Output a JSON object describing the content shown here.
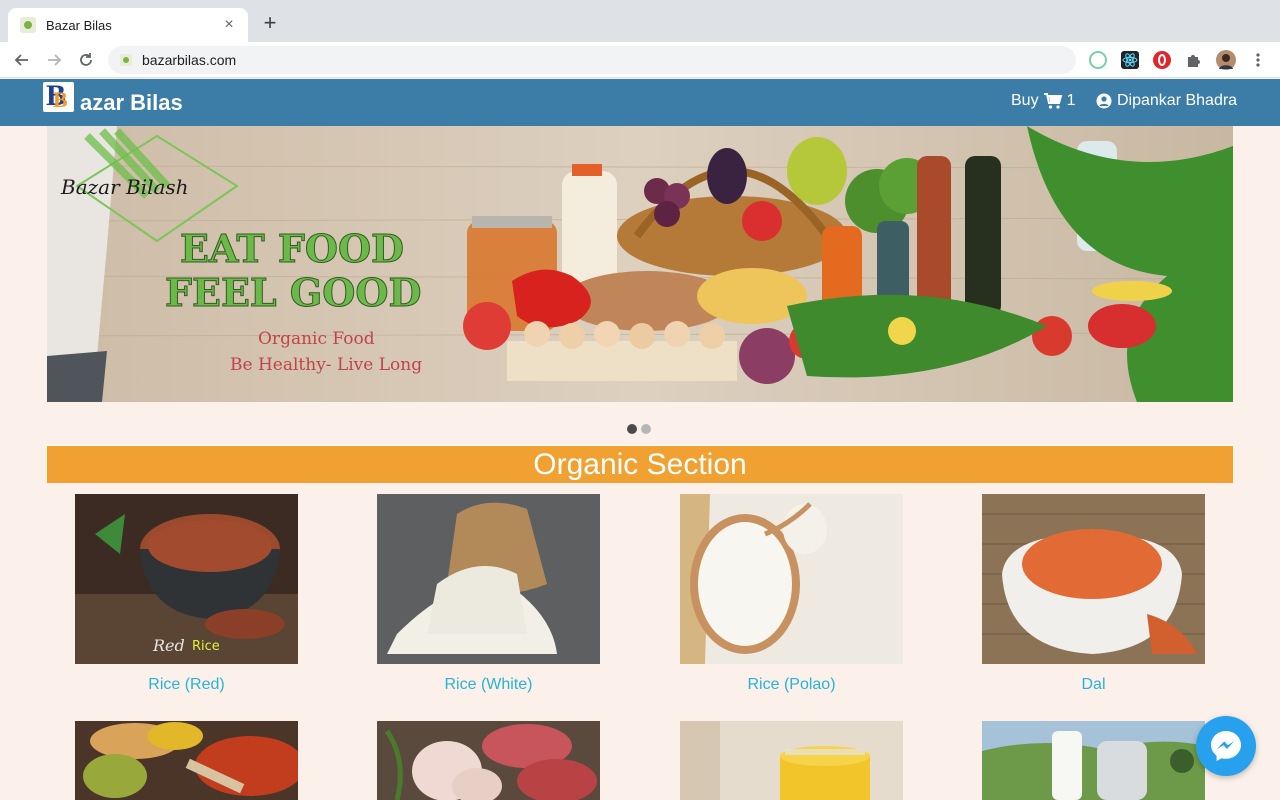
{
  "browser": {
    "tab_title": "Bazar Bilas",
    "close_glyph": "×",
    "new_tab_glyph": "+",
    "url": "bazarbilas.com"
  },
  "header": {
    "brand_name": "azar Bilas",
    "logo_letter": "B",
    "buy_label": "Buy",
    "cart_count": "1",
    "user_name": "Dipankar Bhadra"
  },
  "banner": {
    "brand_script": "Bazar Bilash",
    "headline_1": "EAT FOOD",
    "headline_2": "FEEL GOOD",
    "tagline_1": "Organic Food",
    "tagline_2": "Be Healthy- Live Long",
    "slides_count": 2,
    "active_slide": 1
  },
  "section": {
    "title": "Organic Section"
  },
  "products": [
    {
      "name": "Rice (Red)",
      "overlay_1": "Red",
      "overlay_2": "Rice"
    },
    {
      "name": "Rice (White)"
    },
    {
      "name": "Rice (Polao)"
    },
    {
      "name": "Dal"
    },
    {
      "name": ""
    },
    {
      "name": ""
    },
    {
      "name": ""
    },
    {
      "name": ""
    }
  ],
  "colors": {
    "header_bg": "#3b7da7",
    "section_bar": "#f1a131",
    "product_link": "#2ab2d6",
    "page_bg": "#fbf1ea",
    "messenger": "#27a1ee"
  },
  "icons": {
    "back": "arrow-left-icon",
    "forward": "arrow-right-icon",
    "reload": "reload-icon",
    "cart": "shopping-cart-icon",
    "user": "user-circle-icon",
    "chat": "messenger-icon"
  }
}
